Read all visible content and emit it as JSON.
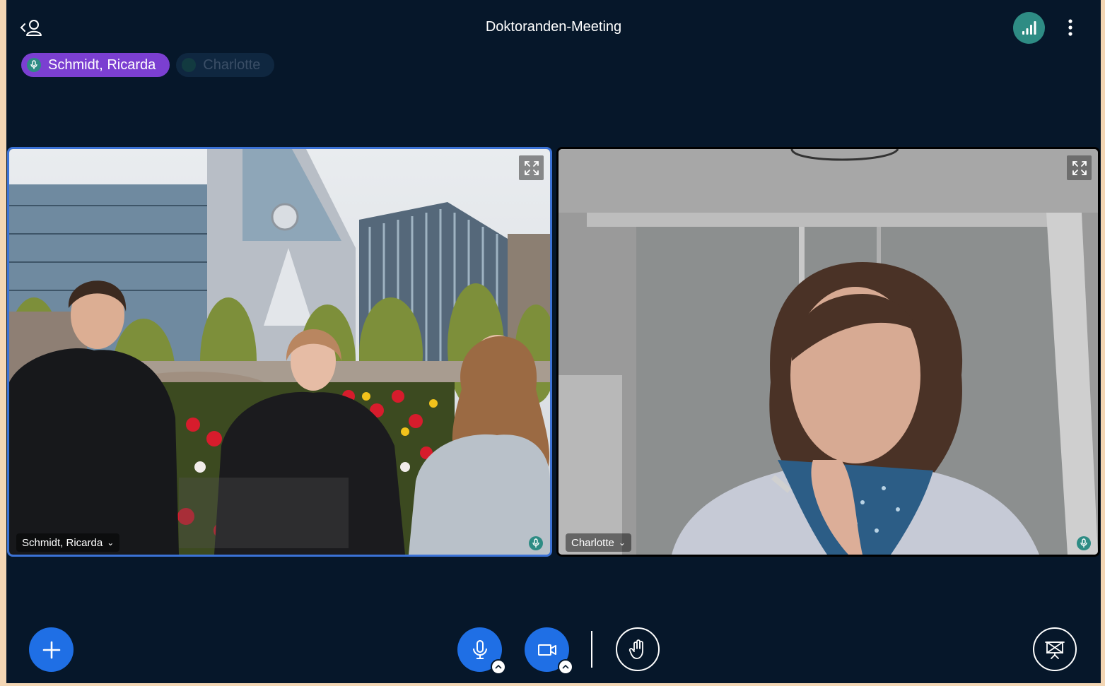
{
  "header": {
    "title": "Doktoranden-Meeting"
  },
  "talkers": [
    {
      "name": "Schmidt, Ricarda",
      "state": "active"
    },
    {
      "name": "Charlotte",
      "state": "inactive"
    }
  ],
  "tiles": [
    {
      "name": "Schmidt, Ricarda",
      "caret": "⌄"
    },
    {
      "name": "Charlotte",
      "caret": "⌄"
    }
  ],
  "icons": {
    "users_toggle": "user-list-icon",
    "connection": "signal-bars-icon",
    "more": "more-vertical-icon",
    "expand": "fullscreen-icon",
    "mic": "microphone-icon",
    "camera": "camera-icon",
    "hand": "raise-hand-icon",
    "presentation": "presentation-icon",
    "add": "plus-icon"
  },
  "colors": {
    "background": "#06172a",
    "accent_blue": "#1f6fe5",
    "talker_active": "#7b3fd1",
    "mic_badge": "#2e8c84",
    "active_tile_border": "#3b72d6"
  }
}
